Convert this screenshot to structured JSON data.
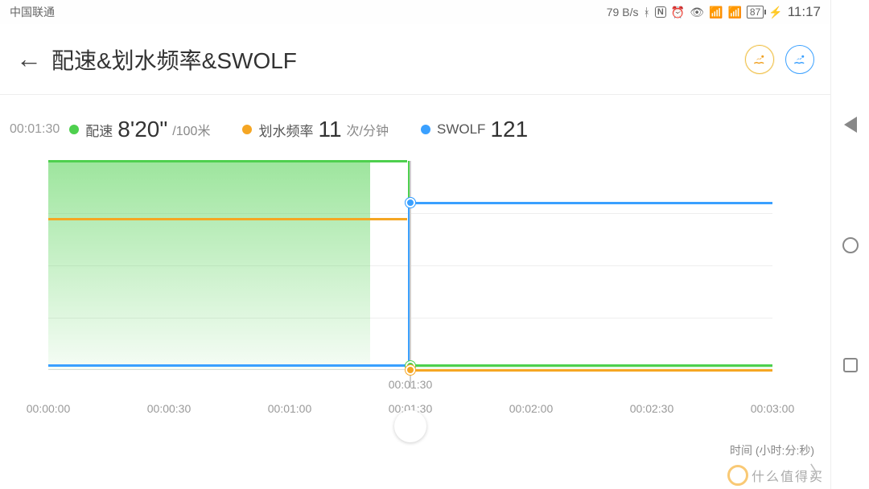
{
  "status": {
    "carrier": "中国联通",
    "speed": "79 B/s",
    "battery": "87",
    "time": "11:17"
  },
  "header": {
    "title": "配速&划水频率&SWOLF"
  },
  "readout": {
    "timestamp": "00:01:30",
    "pace_label": "配速",
    "pace_value": "8'20\"",
    "pace_unit": "/100米",
    "stroke_label": "划水频率",
    "stroke_value": "11",
    "stroke_unit": "次/分钟",
    "swolf_label": "SWOLF",
    "swolf_value": "121"
  },
  "chart_data": {
    "type": "line",
    "xlabel": "时间 (小时:分:秒)",
    "x_ticks": [
      "00:00:00",
      "00:00:30",
      "00:01:00",
      "00:01:30",
      "00:02:00",
      "00:02:30",
      "00:03:00"
    ],
    "scrubber_x": "00:01:30",
    "marker_x": "00:01:30",
    "series": [
      {
        "name": "配速",
        "color": "#4ED04E",
        "unit": "/100米",
        "x": [
          "00:00:00",
          "00:01:20",
          "00:01:30",
          "00:03:00"
        ],
        "values": [
          100,
          100,
          2,
          2
        ],
        "area": true
      },
      {
        "name": "划水频率",
        "color": "#F5A623",
        "unit": "次/分钟",
        "x": [
          "00:00:00",
          "00:01:20",
          "00:01:30",
          "00:03:00"
        ],
        "values": [
          72,
          72,
          0,
          0
        ]
      },
      {
        "name": "SWOLF",
        "color": "#3AA0FF",
        "unit": "",
        "x": [
          "00:00:00",
          "00:01:25",
          "00:01:30",
          "00:03:00"
        ],
        "values": [
          2,
          2,
          80,
          80
        ]
      }
    ],
    "ylim": [
      0,
      100
    ]
  },
  "watermark": "什么值得买",
  "colors": {
    "green": "#4ED04E",
    "orange": "#F5A623",
    "blue": "#3AA0FF"
  }
}
